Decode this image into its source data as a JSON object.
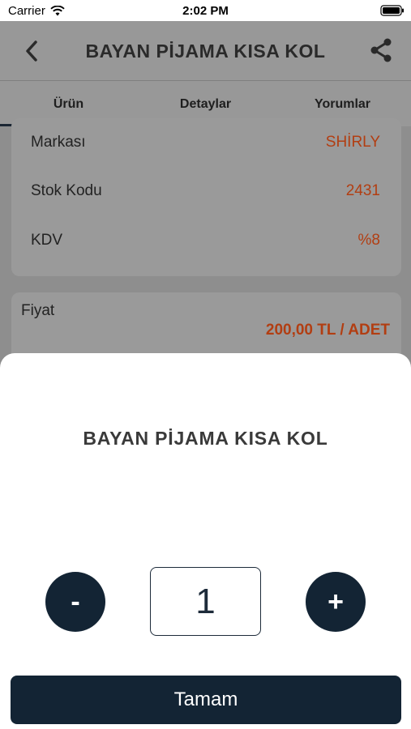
{
  "status_bar": {
    "carrier": "Carrier",
    "time": "2:02 PM"
  },
  "nav": {
    "title": "BAYAN PİJAMA KISA KOL"
  },
  "tabs": [
    {
      "label": "Ürün"
    },
    {
      "label": "Detaylar"
    },
    {
      "label": "Yorumlar"
    }
  ],
  "product_info": [
    {
      "label": "Markası",
      "value": "SHİRLY"
    },
    {
      "label": "Stok Kodu",
      "value": "2431"
    },
    {
      "label": "KDV",
      "value": "%8"
    }
  ],
  "price": {
    "label": "Fiyat",
    "value": "200,00 TL / ADET"
  },
  "sheet": {
    "title": "BAYAN PİJAMA KISA KOL",
    "minus_label": "-",
    "plus_label": "+",
    "quantity": "1",
    "confirm_label": "Tamam"
  },
  "colors": {
    "accent": "#b23e12",
    "primary": "#132434"
  }
}
